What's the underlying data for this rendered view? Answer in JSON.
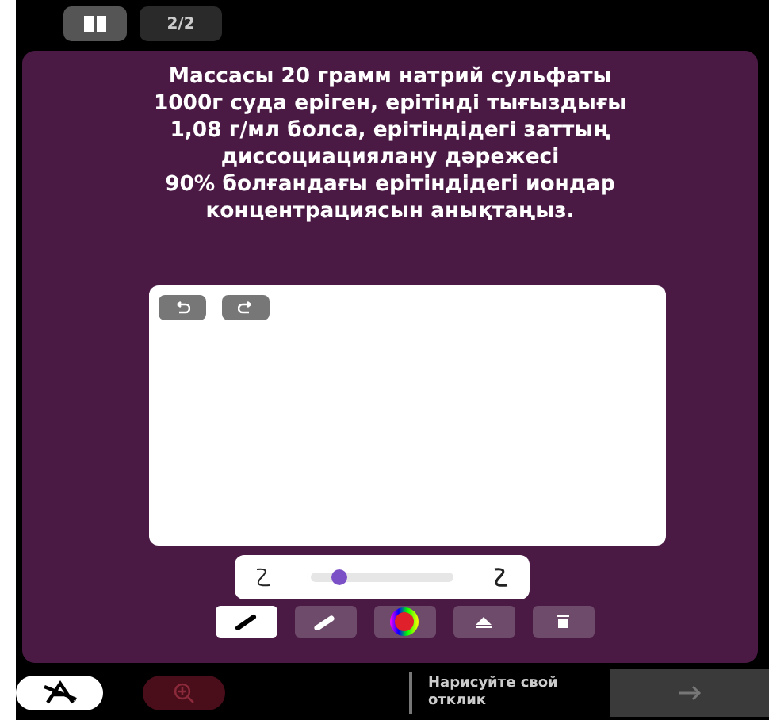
{
  "header": {
    "page_counter": "2/2"
  },
  "question": {
    "lines": [
      "Массасы 20 грамм натрий сульфаты",
      "1000г суда еріген, ерітінді тығыздығы",
      "1,08 г/мл болса, ерітіндідегі заттың",
      "диссоциациялану дәрежесі",
      "90% болғандағы ерітіндідегі иондар",
      "концентрациясын анықтаңыз."
    ]
  },
  "stroke_slider": {
    "level": 0.2
  },
  "tools": [
    {
      "kind": "pen",
      "selected": true
    },
    {
      "kind": "marker",
      "selected": false
    },
    {
      "kind": "color",
      "selected": false
    },
    {
      "kind": "eraser",
      "selected": false
    },
    {
      "kind": "trash",
      "selected": false
    }
  ],
  "footer": {
    "hint": "Нарисуйте свой отклик"
  }
}
